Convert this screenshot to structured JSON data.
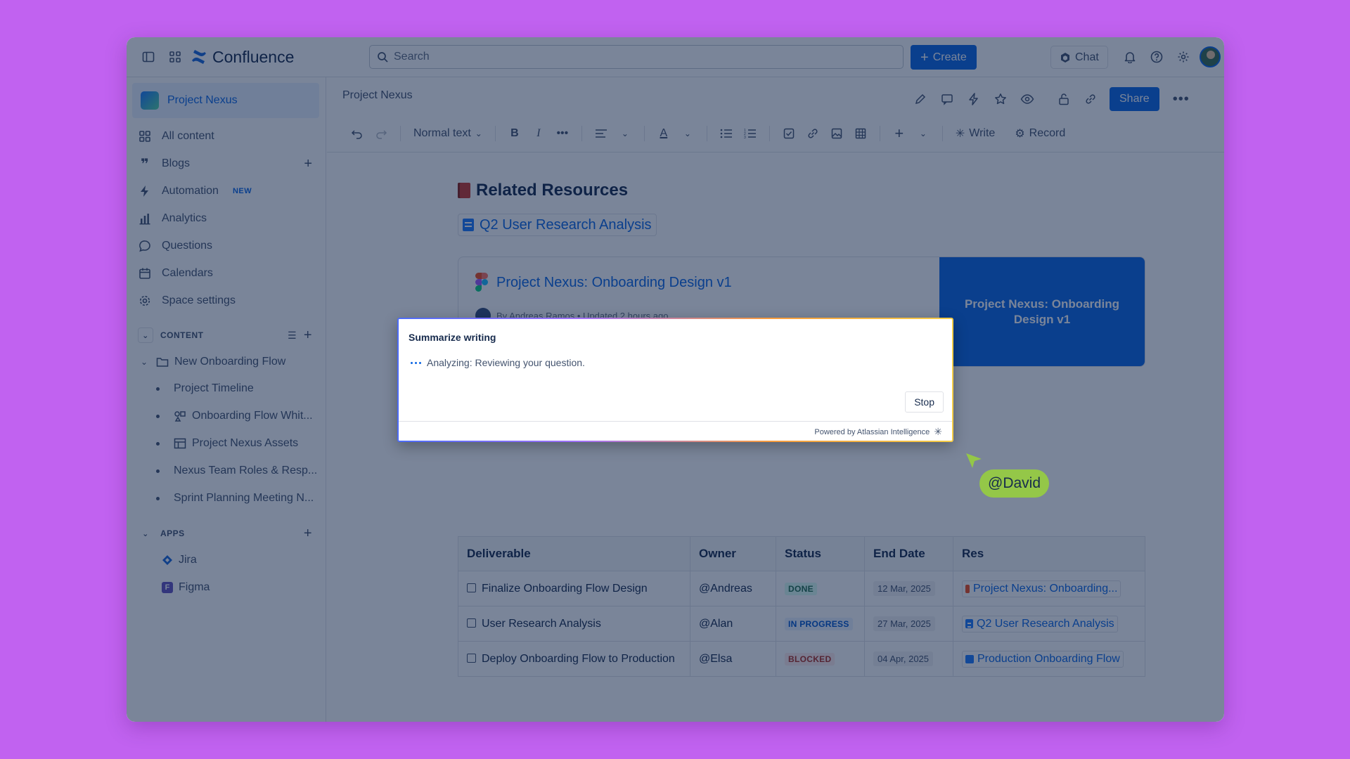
{
  "app": {
    "name": "Confluence"
  },
  "topnav": {
    "search_placeholder": "Search",
    "create_label": "Create",
    "chat_label": "Chat"
  },
  "sidebar": {
    "space_name": "Project Nexus",
    "items": [
      {
        "label": "All content",
        "icon": "grid-icon"
      },
      {
        "label": "Blogs",
        "icon": "quote-icon"
      },
      {
        "label": "Automation",
        "icon": "lightning-icon",
        "badge": "NEW"
      },
      {
        "label": "Analytics",
        "icon": "bar-chart-icon"
      },
      {
        "label": "Questions",
        "icon": "speech-bubble-icon"
      },
      {
        "label": "Calendars",
        "icon": "calendar-icon"
      },
      {
        "label": "Space settings",
        "icon": "gear-icon"
      }
    ],
    "content_section": "CONTENT",
    "tree_root": "New Onboarding Flow",
    "tree_children": [
      "Project Timeline",
      "Onboarding Flow Whit...",
      "Project Nexus Assets",
      "Nexus Team Roles & Resp...",
      "Sprint Planning Meeting N..."
    ],
    "apps_section": "APPS",
    "apps": [
      "Jira",
      "Figma"
    ]
  },
  "page": {
    "breadcrumb": "Project Nexus",
    "share_label": "Share",
    "toolbar": {
      "text_style": "Normal text",
      "write_label": "Write",
      "record_label": "Record"
    },
    "heading": "Related Resources",
    "inline_link": "Q2 User Research Analysis",
    "card": {
      "title": "Project Nexus: Onboarding Design v1",
      "meta": "By Andreas Ramos  •  Updated 2 hours ago",
      "preview_title": "Project Nexus: Onboarding Design v1"
    },
    "table": {
      "headers": [
        "Deliverable",
        "Owner",
        "Status",
        "End Date",
        "Res"
      ],
      "rows": [
        {
          "deliverable": "Finalize Onboarding Flow Design",
          "owner": "@Andreas",
          "status": "DONE",
          "end_date": "12 Mar, 2025",
          "resource": "Project Nexus: Onboarding..."
        },
        {
          "deliverable": "User Research Analysis",
          "owner": "@Alan",
          "status": "IN PROGRESS",
          "end_date": "27 Mar, 2025",
          "resource": "Q2 User Research Analysis"
        },
        {
          "deliverable": "Deploy Onboarding Flow to Production",
          "owner": "@Elsa",
          "status": "BLOCKED",
          "end_date": "04 Apr, 2025",
          "resource": "Production Onboarding Flow"
        }
      ]
    }
  },
  "ai_dialog": {
    "title": "Summarize writing",
    "status": "Analyzing: Reviewing your question.",
    "stop_label": "Stop",
    "footer": "Powered by Atlassian Intelligence"
  },
  "collaborator": {
    "mention": "@David"
  },
  "colors": {
    "background": "#c162f0",
    "accent": "#0c66e4",
    "done": "#216e4e",
    "in_progress": "#0055cc",
    "blocked": "#ae2e24",
    "mention_bg": "#94c748"
  }
}
